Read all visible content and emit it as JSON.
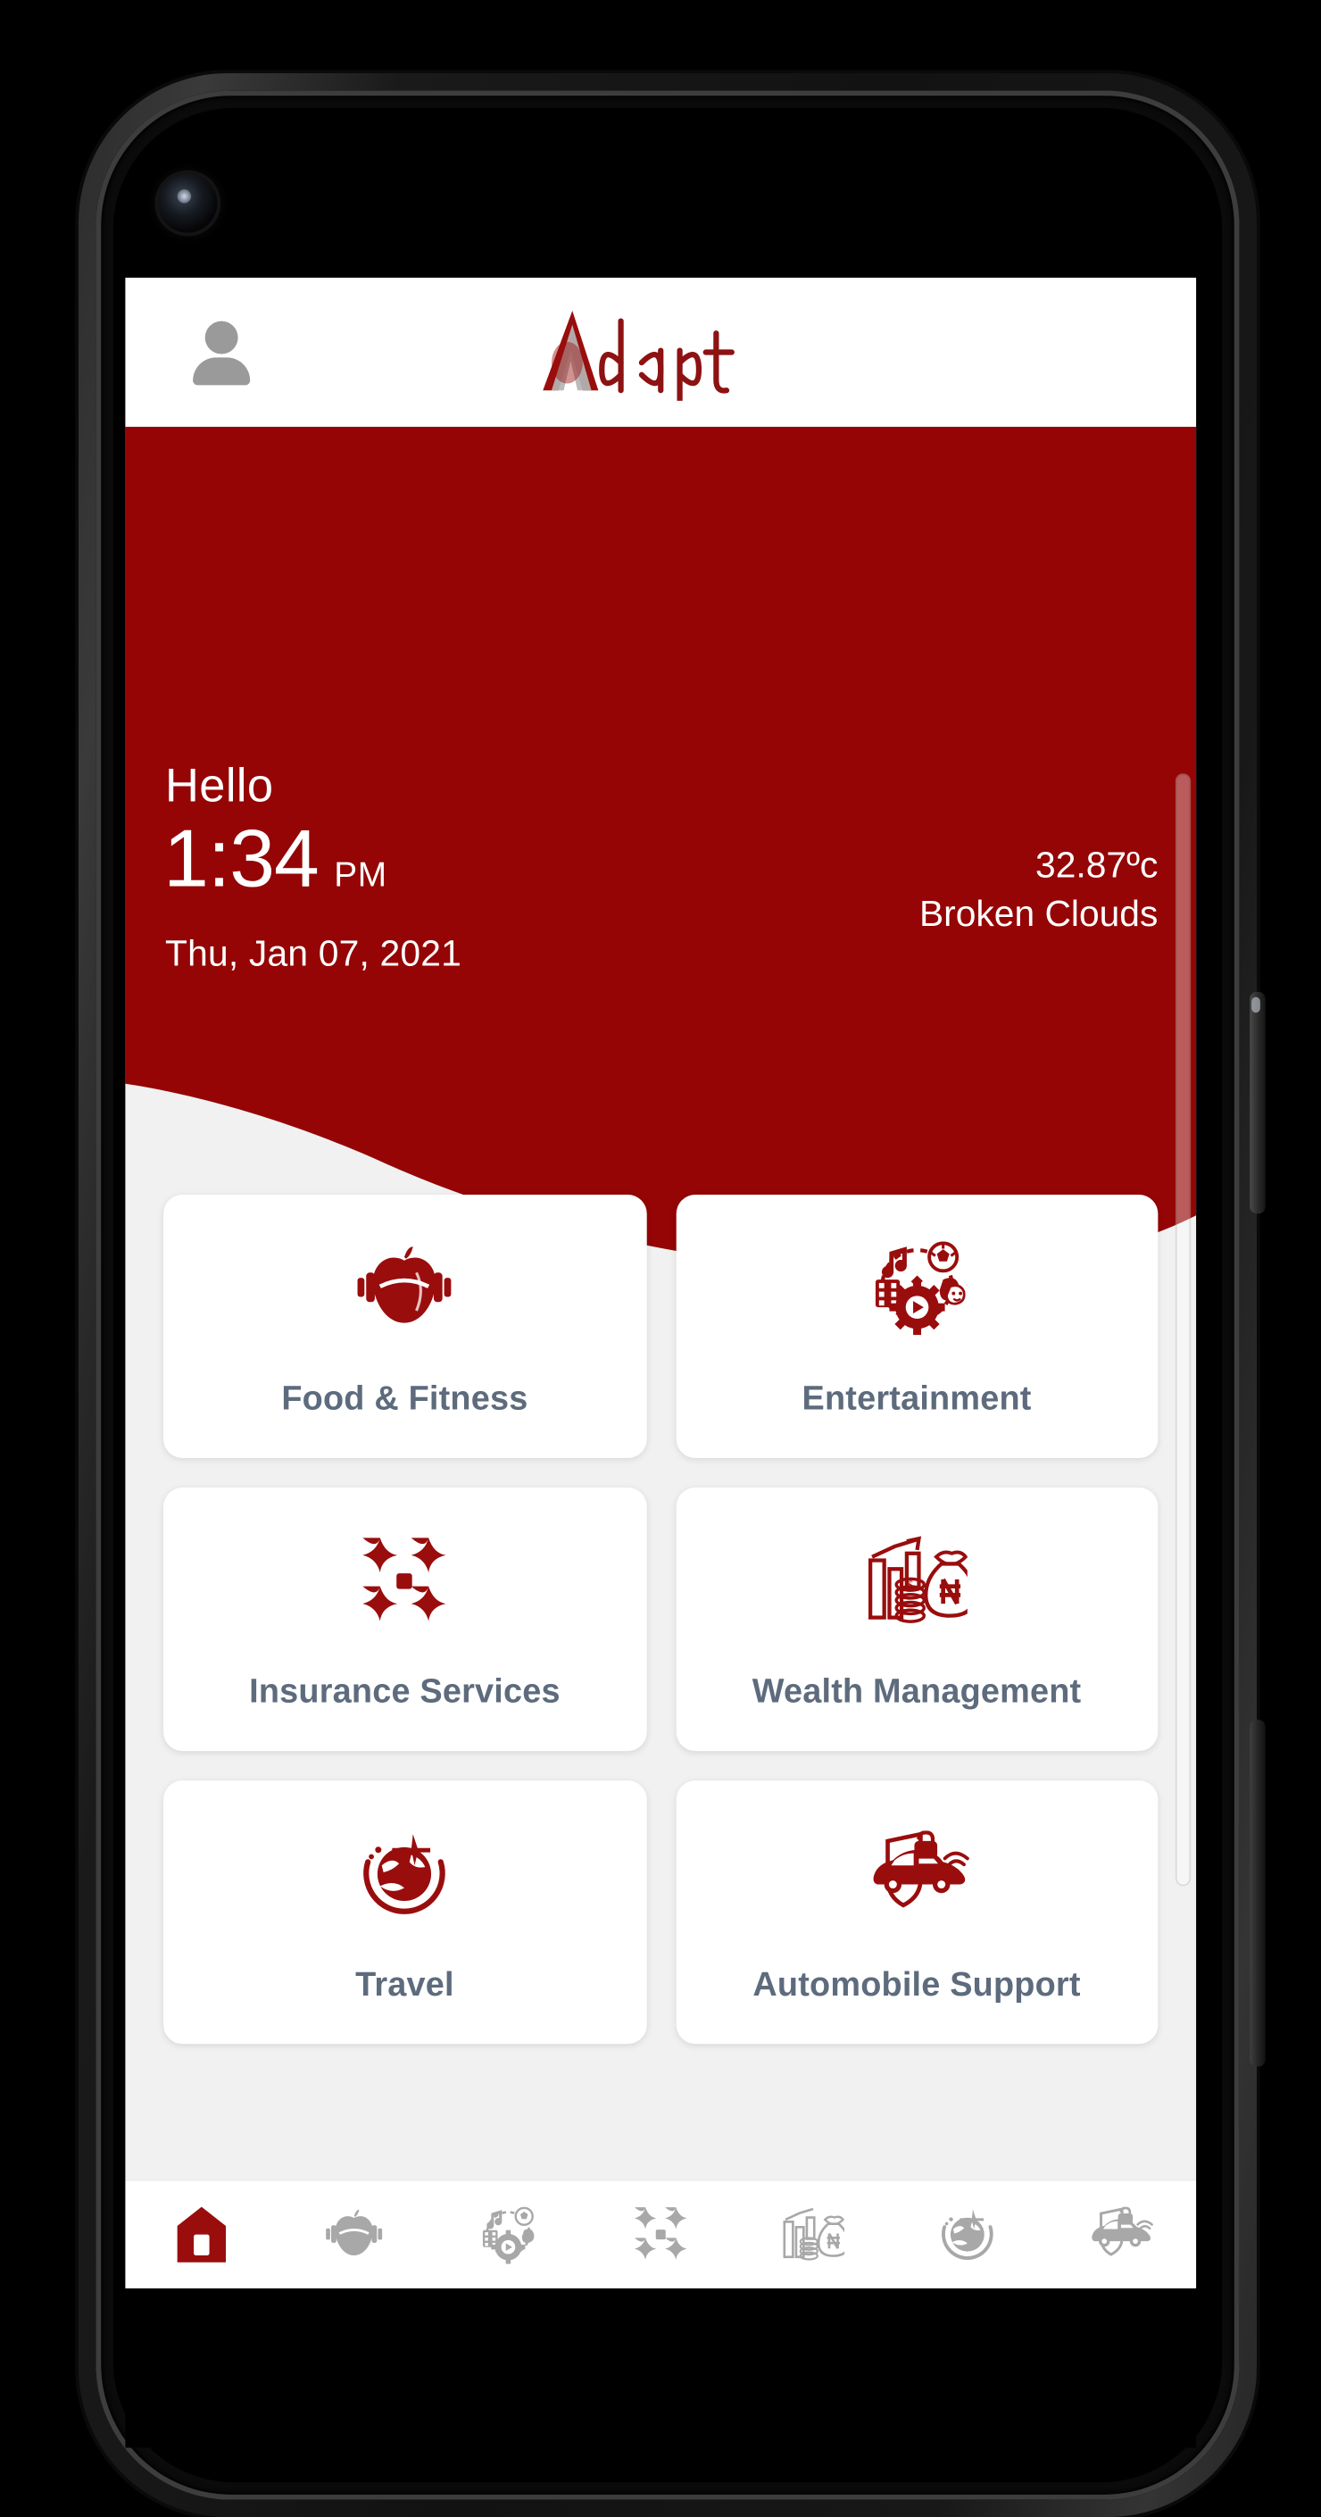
{
  "app": {
    "name": "Adapt",
    "brand_color": "#950505",
    "brand_accent_gray": "#b5b5b5",
    "label_color": "#5d6b7d",
    "background_color": "#f1f1f1"
  },
  "appbar": {
    "profile_icon": "person-icon",
    "logo_text": "Adapt",
    "logo_letter_a": "A",
    "logo_rest": "dapt"
  },
  "hero": {
    "greeting": "Hello",
    "time": "1:34",
    "meridiem": "PM",
    "date": "Thu, Jan 07, 2021",
    "temperature": "32.87ºc",
    "condition": "Broken Clouds"
  },
  "cards": [
    {
      "label": "Food & Fitness",
      "icon": "apple-dumbbell-icon"
    },
    {
      "label": "Entertainment",
      "icon": "entertainment-gear-icon"
    },
    {
      "label": "Insurance Services",
      "icon": "four-star-cluster-icon"
    },
    {
      "label": "Wealth Management",
      "icon": "money-bag-chart-icon"
    },
    {
      "label": "Travel",
      "icon": "globe-airplane-icon"
    },
    {
      "label": "Automobile Support",
      "icon": "car-shield-icon"
    }
  ],
  "bottom_nav": [
    {
      "name": "Home",
      "icon": "home-icon",
      "active": true
    },
    {
      "name": "Food & Fitness",
      "icon": "apple-dumbbell-icon",
      "active": false
    },
    {
      "name": "Entertainment",
      "icon": "entertainment-gear-icon",
      "active": false
    },
    {
      "name": "Insurance Services",
      "icon": "four-star-cluster-icon",
      "active": false
    },
    {
      "name": "Wealth Management",
      "icon": "money-bag-chart-icon",
      "active": false
    },
    {
      "name": "Travel",
      "icon": "globe-airplane-icon",
      "active": false
    },
    {
      "name": "Automobile Support",
      "icon": "car-shield-icon",
      "active": false
    }
  ]
}
